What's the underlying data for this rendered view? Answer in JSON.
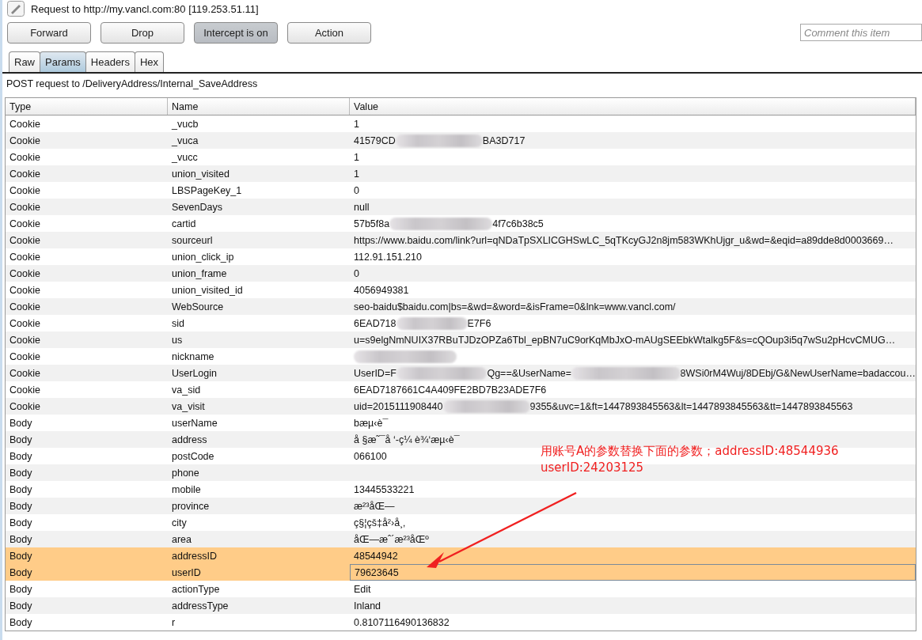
{
  "request_title": "Request to http://my.vancl.com:80  [119.253.51.11]",
  "buttons": [
    {
      "label": "Forward",
      "pressed": false
    },
    {
      "label": "Drop",
      "pressed": false
    },
    {
      "label": "Intercept is on",
      "pressed": true
    },
    {
      "label": "Action",
      "pressed": false
    }
  ],
  "comment": {
    "placeholder": "Comment this item"
  },
  "tabs": [
    {
      "label": "Raw",
      "selected": false
    },
    {
      "label": "Params",
      "selected": true
    },
    {
      "label": "Headers",
      "selected": false
    },
    {
      "label": "Hex",
      "selected": false
    }
  ],
  "request_line": "POST request to /DeliveryAddress/Internal_SaveAddress",
  "table": {
    "columns": [
      "Type",
      "Name",
      "Value"
    ],
    "rows": [
      {
        "type": "Cookie",
        "name": "_vucb",
        "value": "1",
        "redacted": false,
        "selected": false,
        "focused": false
      },
      {
        "type": "Cookie",
        "name": "_vuca",
        "value": "41579CD",
        "redacted": true,
        "value_end": "BA3D717",
        "selected": false,
        "focused": false
      },
      {
        "type": "Cookie",
        "name": "_vucc",
        "value": "1",
        "redacted": false,
        "selected": false,
        "focused": false
      },
      {
        "type": "Cookie",
        "name": "union_visited",
        "value": "1",
        "redacted": false,
        "selected": false,
        "focused": false
      },
      {
        "type": "Cookie",
        "name": "LBSPageKey_1",
        "value": "0",
        "redacted": false,
        "selected": false,
        "focused": false
      },
      {
        "type": "Cookie",
        "name": "SevenDays",
        "value": "null",
        "redacted": false,
        "selected": false,
        "focused": false
      },
      {
        "type": "Cookie",
        "name": "cartid",
        "value": "57b5f8a",
        "redacted": true,
        "value_end": "4f7c6b38c5",
        "selected": false,
        "focused": false
      },
      {
        "type": "Cookie",
        "name": "sourceurl",
        "value": "https://www.baidu.com/link?url=qNDaTpSXLICGHSwLC_5qTKcyGJ2n8jm583WKhUjgr_u&wd=&eqid=a89dde8d0003669…",
        "redacted": false,
        "selected": false,
        "focused": false
      },
      {
        "type": "Cookie",
        "name": "union_click_ip",
        "value": "112.91.151.210",
        "redacted": false,
        "selected": false,
        "focused": false
      },
      {
        "type": "Cookie",
        "name": "union_frame",
        "value": "0",
        "redacted": false,
        "selected": false,
        "focused": false
      },
      {
        "type": "Cookie",
        "name": "union_visited_id",
        "value": "4056949381",
        "redacted": false,
        "selected": false,
        "focused": false
      },
      {
        "type": "Cookie",
        "name": "WebSource",
        "value": "seo-baidu$baidu.com|bs=&wd=&word=&isFrame=0&lnk=www.vancl.com/",
        "redacted": false,
        "selected": false,
        "focused": false
      },
      {
        "type": "Cookie",
        "name": "sid",
        "value": "6EAD718",
        "redacted": true,
        "value_end": "E7F6",
        "selected": false,
        "focused": false
      },
      {
        "type": "Cookie",
        "name": "us",
        "value": "u=s9elgNmNUIX37RBuTJDzOPZa6Tbl_epBN7uC9orKqMbJxO-mAUgSEEbkWtalkg5F&s=cQOup3i5q7wSu2pHcvCMUG…",
        "redacted": false,
        "selected": false,
        "focused": false
      },
      {
        "type": "Cookie",
        "name": "nickname",
        "redacted": true,
        "selected": false,
        "focused": false
      },
      {
        "type": "Cookie",
        "name": "UserLogin",
        "value": "UserID=F",
        "redacted": true,
        "value_end": "Qg==&UserName=",
        "redacted2": true,
        "value_end2": "8WSi0rM4Wuj/8DEbj/G&NewUserName=badaccou…",
        "selected": false,
        "focused": false
      },
      {
        "type": "Cookie",
        "name": "va_sid",
        "value": "6EAD7187661C4A409FE2BD7B23ADE7F6",
        "redacted": false,
        "selected": false,
        "focused": false
      },
      {
        "type": "Cookie",
        "name": "va_visit",
        "value": "uid=2015111908440",
        "redacted": true,
        "value_end": "9355&uvc=1&ft=1447893845563&lt=1447893845563&tt=1447893845563",
        "selected": false,
        "focused": false
      },
      {
        "type": "Body",
        "name": "userName",
        "value": "bæµ‹è¯",
        "redacted": false,
        "selected": false,
        "focused": false
      },
      {
        "type": "Body",
        "name": "address",
        "value": "å §æ˜¯å  ‘-ç¼­ è¾‘æµ‹è¯",
        "redacted": false,
        "selected": false,
        "focused": false
      },
      {
        "type": "Body",
        "name": "postCode",
        "value": "066100",
        "redacted": false,
        "selected": false,
        "focused": false,
        "note": "用账号A的参数替换下面的参数；addressID:48544936"
      },
      {
        "type": "Body",
        "name": "phone",
        "redacted": false,
        "selected": false,
        "focused": false,
        "note": "userID:24203125"
      },
      {
        "type": "Body",
        "name": "mobile",
        "value": "13445533221",
        "redacted": false,
        "selected": false,
        "focused": false
      },
      {
        "type": "Body",
        "name": "province",
        "value": "æ²³åŒ—",
        "redacted": false,
        "selected": false,
        "focused": false
      },
      {
        "type": "Body",
        "name": "city",
        "value": "ç§¦çš‡å²›å¸‚",
        "redacted": false,
        "selected": false,
        "focused": false
      },
      {
        "type": "Body",
        "name": "area",
        "value": "åŒ—æˆ´æ²³åŒº",
        "redacted": false,
        "selected": false,
        "focused": false
      },
      {
        "type": "Body",
        "name": "addressID",
        "value": "48544942",
        "redacted": false,
        "selected": true,
        "focused": false
      },
      {
        "type": "Body",
        "name": "userID",
        "value": "79623645",
        "redacted": false,
        "selected": true,
        "focused": true
      },
      {
        "type": "Body",
        "name": "actionType",
        "value": "Edit",
        "redacted": false,
        "selected": false,
        "focused": false
      },
      {
        "type": "Body",
        "name": "addressType",
        "value": "Inland",
        "redacted": false,
        "selected": false,
        "focused": false
      },
      {
        "type": "Body",
        "name": "r",
        "value": "0.8107116490136832",
        "redacted": false,
        "selected": false,
        "focused": false
      }
    ]
  }
}
